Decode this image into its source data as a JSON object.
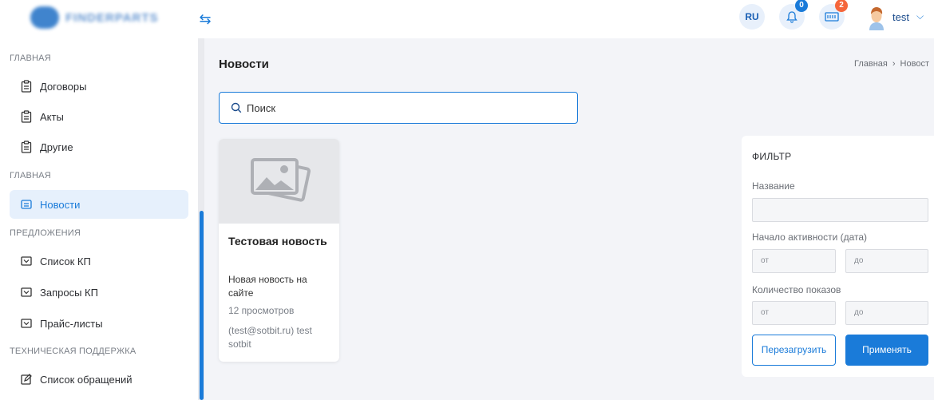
{
  "header": {
    "logo_text": "FINDERPARTS",
    "lang": "RU",
    "notifications_count": "0",
    "cart_count": "2",
    "user_name": "test"
  },
  "sidebar": {
    "sections": [
      {
        "title": "ГЛАВНАЯ",
        "items": [
          {
            "label": "Договоры",
            "icon": "clipboard-icon"
          },
          {
            "label": "Акты",
            "icon": "clipboard-icon"
          },
          {
            "label": "Другие",
            "icon": "clipboard-icon"
          }
        ]
      },
      {
        "title": "ГЛАВНАЯ",
        "items": [
          {
            "label": "Новости",
            "icon": "news-icon",
            "active": true
          }
        ]
      },
      {
        "title": "ПРЕДЛОЖЕНИЯ",
        "items": [
          {
            "label": "Список КП",
            "icon": "inbox-icon"
          },
          {
            "label": "Запросы КП",
            "icon": "inbox-icon"
          },
          {
            "label": "Прайс-листы",
            "icon": "inbox-icon"
          }
        ]
      },
      {
        "title": "ТЕХНИЧЕСКАЯ ПОДДЕРЖКА",
        "items": [
          {
            "label": "Список обращений",
            "icon": "edit-icon"
          }
        ]
      }
    ]
  },
  "main": {
    "title": "Новости",
    "breadcrumb": [
      "Главная",
      "Новост"
    ],
    "search_placeholder": "Поиск"
  },
  "news": [
    {
      "title": "Тестовая новость",
      "text": "Новая новость на сайте",
      "views": "12 просмотров",
      "author": "(test@sotbit.ru) test sotbit"
    }
  ],
  "filter": {
    "title": "ФИЛЬТР",
    "name_label": "Название",
    "name_value": "",
    "date_label": "Начало активности (дата)",
    "date_from": "от",
    "date_to": "до",
    "shows_label": "Количество показов",
    "shows_from": "от",
    "shows_to": "до",
    "reset_label": "Перезагрузить",
    "apply_label": "Применять"
  },
  "colors": {
    "accent": "#1a7bd9",
    "badge_orange": "#f5663b"
  }
}
